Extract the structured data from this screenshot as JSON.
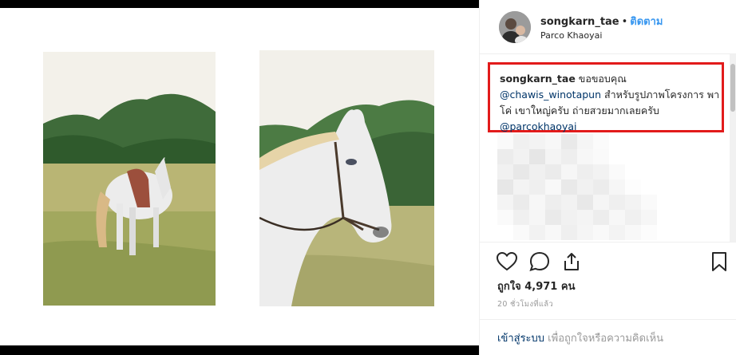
{
  "post": {
    "username": "songkarn_tae",
    "separator": "•",
    "follow_label": "ติดตาม",
    "location": "Parco Khaoyai"
  },
  "caption": {
    "username": "songkarn_tae",
    "text_1": " ขอขอบคุณ",
    "mention_1": "@chawis_winotapun",
    "text_2": " สำหรับรูปภาพโครงการ พาโค่ เขาใหญ่ครับ ถ่ายสวยมากเลยครับ",
    "mention_2": "@parcokhaoyai"
  },
  "actions": {
    "likes": "ถูกใจ 4,971 คน",
    "time": "20 ชั่วโมงที่แล้ว",
    "login_link": "เข้าสู่ระบบ",
    "login_rest": " เพื่อถูกใจหรือความคิดเห็น"
  },
  "icons": {
    "like": "heart-icon",
    "comment": "comment-icon",
    "share": "share-icon",
    "save": "bookmark-icon"
  },
  "colors": {
    "follow": "#3897f0",
    "highlight_border": "#e21b1b",
    "link": "#003569"
  }
}
